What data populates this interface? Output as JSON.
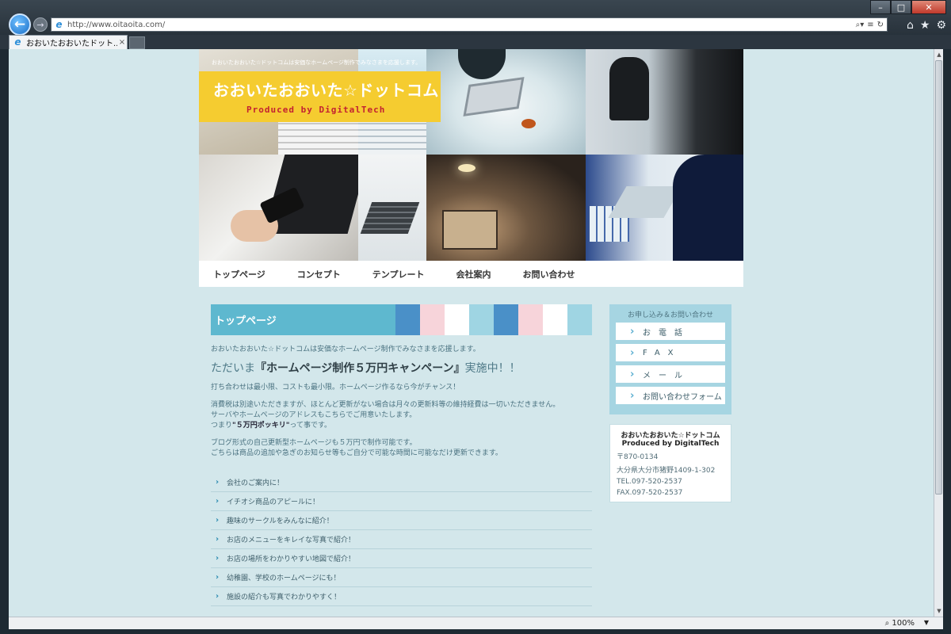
{
  "browser": {
    "url": "http://www.oitaoita.com/",
    "tab_title": "おおいたおおいたドット...",
    "zoom": "100%",
    "window_controls": {
      "minimize": "–",
      "maximize": "□",
      "close": "✕"
    },
    "icons": {
      "back": "←",
      "forward": "→",
      "search": "⌕▾",
      "compat": "≡",
      "refresh": "↻",
      "home": "⌂",
      "favorites": "★",
      "tools": "⚙",
      "tab_close": "×",
      "zoom": "⌕"
    }
  },
  "site": {
    "header_tagline": "おおいたおおいた☆ドットコムは安価なホームページ制作でみなさまを応援します。",
    "logo_title": "おおいたおおいた☆ドットコム",
    "logo_sub": "Produced by DigitalTech",
    "logo_color": "#f5cc30",
    "menu": [
      "トップページ",
      "コンセプト",
      "テンプレート",
      "会社案内",
      "お問い合わせ"
    ],
    "section_title": "トップページ",
    "section_color": "#5eb8cf",
    "swatches": [
      "#4a90c8",
      "#f7d4da",
      "#ffffff",
      "#9fd5e3",
      "#4a90c8",
      "#f7d4da",
      "#ffffff",
      "#9fd5e3"
    ],
    "intro": "おおいたおおいた☆ドットコムは安価なホームページ制作でみなさまを応援します。",
    "campaign_pre": "ただいま",
    "campaign_em": "『ホームページ制作５万円キャンペーン』",
    "campaign_post": "実施中！！",
    "para1": "打ち合わせは最小限、コストも最小限。ホームページ作るなら今がチャンス！",
    "para2_l1": "消費税は別途いただきますが、ほとんど更新がない場合は月々の更新料等の維持経費は一切いただきません。",
    "para2_l2": "サーバやホームページのアドレスもこちらでご用意いたします。",
    "para2_l3_pre": "つまり",
    "para2_l3_em": "\"５万円ポッキリ\"",
    "para2_l3_post": "って事です。",
    "para3_l1": "ブログ形式の自己更新型ホームページも５万円で制作可能です。",
    "para3_l2": "ごちらは商品の追加や急ぎのお知らせ等もご自分で可能な時間に可能なだけ更新できます。",
    "list": [
      "会社のご案内に！",
      "イチオシ商品のアピールに！",
      "趣味のサークルをみんなに紹介！",
      "お店のメニューをキレイな写真で紹介！",
      "お店の場所をわかりやすい地図で紹介！",
      "幼稚園、学校のホームページにも！",
      "施設の紹介も写真でわかりやすく！"
    ],
    "contact_head": "お申し込み＆お問い合わせ",
    "contact_buttons": [
      "お電話",
      "FAX",
      "メール",
      "お問い合わせフォーム"
    ],
    "company_name": "おおいたおおいた☆ドットコム",
    "company_sub": "Produced by DigitalTech",
    "postal": "〒870-0134",
    "address": "大分県大分市猪野1409-1-302",
    "tel": "TEL.097-520-2537",
    "fax": "FAX.097-520-2537"
  }
}
